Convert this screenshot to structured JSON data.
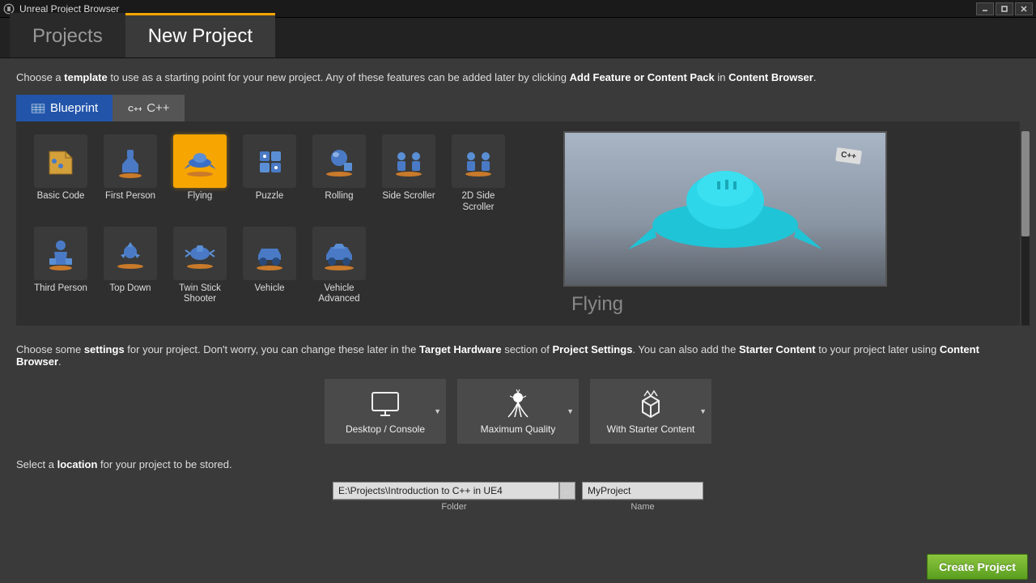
{
  "window": {
    "title": "Unreal Project Browser"
  },
  "main_tabs": {
    "projects": "Projects",
    "new_project": "New Project"
  },
  "intro": {
    "text_pre": "Choose a ",
    "b1": "template",
    "text_mid": " to use as a starting point for your new project.  Any of these features can be added later by clicking ",
    "b2": "Add Feature or Content Pack",
    "text_in": " in ",
    "b3": "Content Browser",
    "text_end": "."
  },
  "sub_tabs": {
    "blueprint": "Blueprint",
    "cpp": "C++"
  },
  "templates": [
    {
      "id": "basic-code",
      "label": "Basic Code"
    },
    {
      "id": "first-person",
      "label": "First Person"
    },
    {
      "id": "flying",
      "label": "Flying",
      "selected": true
    },
    {
      "id": "puzzle",
      "label": "Puzzle"
    },
    {
      "id": "rolling",
      "label": "Rolling"
    },
    {
      "id": "side-scroller",
      "label": "Side Scroller"
    },
    {
      "id": "2d-side-scroller",
      "label": "2D Side Scroller"
    },
    {
      "id": "third-person",
      "label": "Third Person"
    },
    {
      "id": "top-down",
      "label": "Top Down"
    },
    {
      "id": "twin-stick-shooter",
      "label": "Twin Stick Shooter"
    },
    {
      "id": "vehicle",
      "label": "Vehicle"
    },
    {
      "id": "vehicle-advanced",
      "label": "Vehicle Advanced"
    }
  ],
  "preview": {
    "title": "Flying",
    "badge": "C++"
  },
  "settings_intro": {
    "p1": "Choose some ",
    "b1": "settings",
    "p2": " for your project.  Don't worry, you can change these later in the ",
    "b2": "Target Hardware",
    "p3": " section of ",
    "b3": "Project Settings",
    "p4": ".  You can also add the ",
    "b4": "Starter Content",
    "p5": " to your project later using ",
    "b5": "Content Browser",
    "p6": "."
  },
  "settings": {
    "target": "Desktop / Console",
    "quality": "Maximum Quality",
    "starter": "With Starter Content"
  },
  "location": {
    "intro_p1": "Select a ",
    "intro_b": "location",
    "intro_p2": " for your project to be stored.",
    "folder_value": "E:\\Projects\\Introduction to C++ in UE4",
    "folder_label": "Folder",
    "browse": "...",
    "name_value": "MyProject",
    "name_label": "Name"
  },
  "create_button": "Create Project"
}
